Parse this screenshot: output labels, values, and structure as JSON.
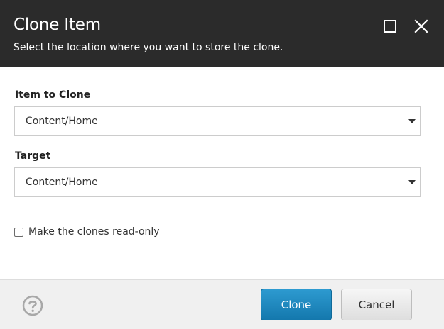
{
  "dialog": {
    "title": "Clone Item",
    "subtitle": "Select the location where you want to store the clone."
  },
  "fields": {
    "item_to_clone": {
      "label": "Item to Clone",
      "value": "Content/Home"
    },
    "target": {
      "label": "Target",
      "value": "Content/Home"
    }
  },
  "options": {
    "readonly_label": "Make the clones read-only",
    "readonly_checked": false
  },
  "footer": {
    "clone_label": "Clone",
    "cancel_label": "Cancel"
  },
  "icons": {
    "maximize": "maximize-icon",
    "close": "close-icon",
    "dropdown": "caret-down-icon",
    "help": "help-icon"
  },
  "colors": {
    "header_bg": "#2b2b2b",
    "primary_button": "#1f87bd",
    "footer_bg": "#f0f0f0"
  }
}
